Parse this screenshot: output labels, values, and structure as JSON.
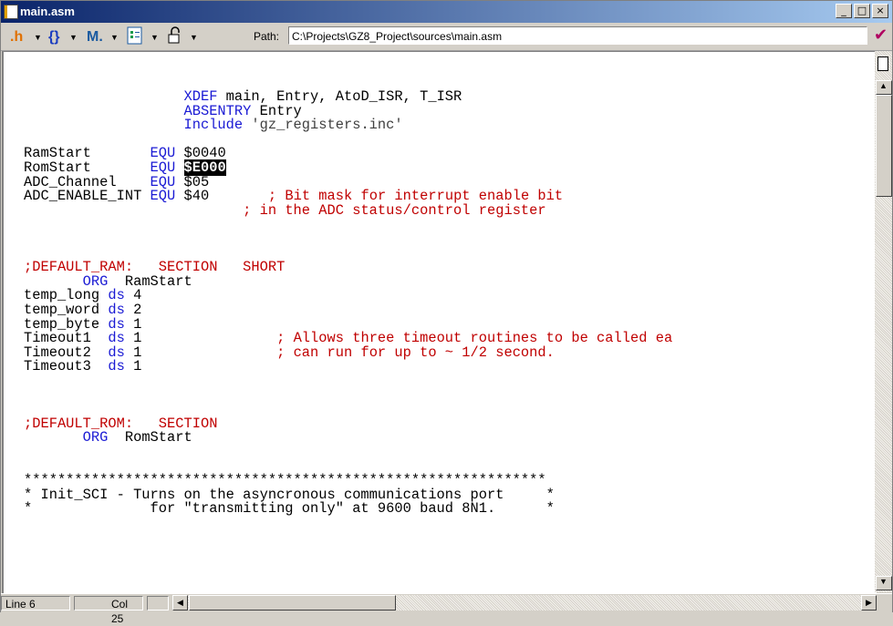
{
  "window": {
    "title": "main.asm"
  },
  "title_buttons": {
    "minimize": "_",
    "maximize": "□",
    "close": "×"
  },
  "toolbar": {
    "path_label": "Path:",
    "path_value": "C:\\Projects\\GZ8_Project\\sources\\main.asm",
    "icons": [
      "hash-sort-icon",
      "braces-icon",
      "bookmark-m-icon",
      "document-list-icon",
      "unlock-icon",
      "check-icon"
    ],
    "accent_colors": {
      "hash": "#e07000",
      "braces": "#1a3cc0",
      "bookmark": "#1a5aa0",
      "check": "#b00060"
    }
  },
  "code_lines": [
    [
      {
        "t": "                   "
      },
      {
        "t": "XDEF",
        "c": "kw"
      },
      {
        "t": " main, Entry, AtoD_ISR, T_ISR"
      }
    ],
    [
      {
        "t": "                   "
      },
      {
        "t": "ABSENTRY",
        "c": "kw"
      },
      {
        "t": " Entry"
      }
    ],
    [
      {
        "t": "                   "
      },
      {
        "t": "Include",
        "c": "kw"
      },
      {
        "t": " 'gz_registers.inc'",
        "c": "str"
      }
    ],
    [
      {
        "t": ""
      }
    ],
    [
      {
        "t": "RamStart       "
      },
      {
        "t": "EQU",
        "c": "kw"
      },
      {
        "t": " $0040"
      }
    ],
    [
      {
        "t": "RomStart       "
      },
      {
        "t": "EQU",
        "c": "kw"
      },
      {
        "t": " "
      },
      {
        "t": "$E000",
        "c": "sel"
      }
    ],
    [
      {
        "t": "ADC_Channel    "
      },
      {
        "t": "EQU",
        "c": "kw"
      },
      {
        "t": " $05"
      }
    ],
    [
      {
        "t": "ADC_ENABLE_INT "
      },
      {
        "t": "EQU",
        "c": "kw"
      },
      {
        "t": " $40       "
      },
      {
        "t": "; Bit mask for interrupt enable bit",
        "c": "cm"
      }
    ],
    [
      {
        "t": "                          "
      },
      {
        "t": "; in the ADC status/control register",
        "c": "cm"
      }
    ],
    [
      {
        "t": ""
      }
    ],
    [
      {
        "t": ""
      }
    ],
    [
      {
        "t": ""
      }
    ],
    [
      {
        "t": ";DEFAULT_RAM:   SECTION   SHORT",
        "c": "cm"
      }
    ],
    [
      {
        "t": "       "
      },
      {
        "t": "ORG",
        "c": "kw"
      },
      {
        "t": "  RamStart"
      }
    ],
    [
      {
        "t": "temp_long "
      },
      {
        "t": "ds",
        "c": "kw"
      },
      {
        "t": " 4"
      }
    ],
    [
      {
        "t": "temp_word "
      },
      {
        "t": "ds",
        "c": "kw"
      },
      {
        "t": " 2"
      }
    ],
    [
      {
        "t": "temp_byte "
      },
      {
        "t": "ds",
        "c": "kw"
      },
      {
        "t": " 1"
      }
    ],
    [
      {
        "t": "Timeout1  "
      },
      {
        "t": "ds",
        "c": "kw"
      },
      {
        "t": " 1                "
      },
      {
        "t": "; Allows three timeout routines to be called ea",
        "c": "cm"
      }
    ],
    [
      {
        "t": "Timeout2  "
      },
      {
        "t": "ds",
        "c": "kw"
      },
      {
        "t": " 1                "
      },
      {
        "t": "; can run for up to ~ 1/2 second.",
        "c": "cm"
      }
    ],
    [
      {
        "t": "Timeout3  "
      },
      {
        "t": "ds",
        "c": "kw"
      },
      {
        "t": " 1"
      }
    ],
    [
      {
        "t": ""
      }
    ],
    [
      {
        "t": ""
      }
    ],
    [
      {
        "t": ""
      }
    ],
    [
      {
        "t": ";DEFAULT_ROM:   SECTION",
        "c": "cm"
      }
    ],
    [
      {
        "t": "       "
      },
      {
        "t": "ORG",
        "c": "kw"
      },
      {
        "t": "  RomStart"
      }
    ],
    [
      {
        "t": ""
      }
    ],
    [
      {
        "t": ""
      }
    ],
    [
      {
        "t": "**************************************************************"
      }
    ],
    [
      {
        "t": "* Init_SCI - Turns on the asyncronous communications port     *"
      }
    ],
    [
      {
        "t": "*              for \"transmitting only\" at 9600 baud 8N1.      *"
      }
    ]
  ],
  "statusbar": {
    "line": "Line 6",
    "col": "Col 25"
  },
  "colors": {
    "keyword": "#1a1ad4",
    "comment": "#c00000",
    "text": "#000000",
    "selection_bg": "#000000",
    "selection_fg": "#ffffff"
  }
}
